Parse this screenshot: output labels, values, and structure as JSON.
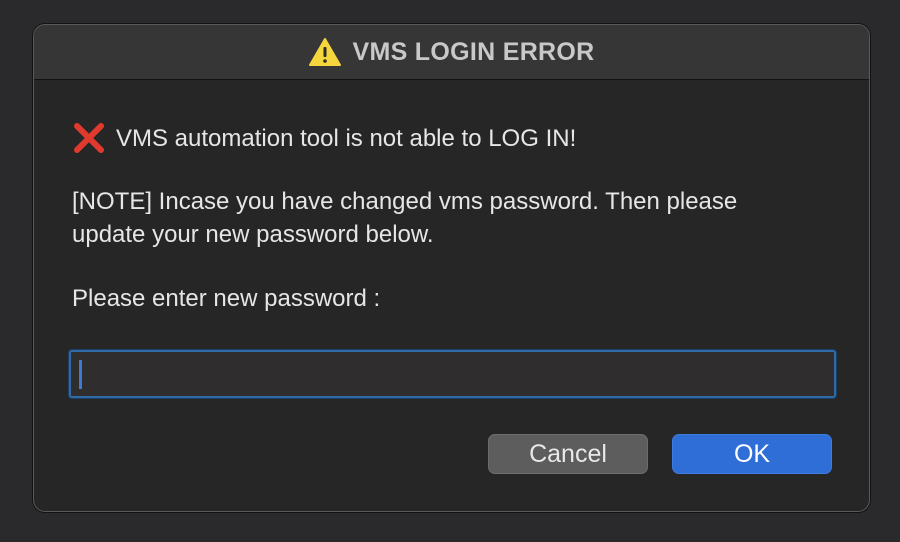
{
  "dialog": {
    "title": "VMS LOGIN ERROR",
    "title_icon": "warning-triangle-icon",
    "error_icon": "red-x-icon",
    "error_message": "VMS automation tool is not able to LOG IN!",
    "note_line1": "[NOTE] Incase you have changed vms password. Then please",
    "note_line2": "update your new password below.",
    "prompt": "Please enter new password :",
    "password_value": "",
    "cancel_label": "Cancel",
    "ok_label": "OK"
  },
  "colors": {
    "warning": "#f5d63c",
    "error": "#e03a2f",
    "accent": "#2f6ed6",
    "background": "#272626"
  }
}
